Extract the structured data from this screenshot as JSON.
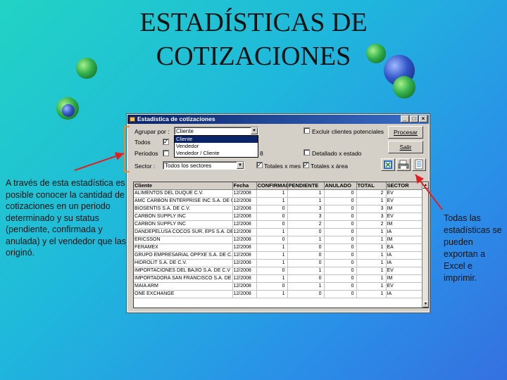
{
  "slide": {
    "title_line1": "ESTADÍSTICAS DE",
    "title_line2": "COTIZACIONES",
    "note_left": "A través de esta estadística es posible conocer la cantidad de cotizaciones en un periodo determinado y su status (pendiente, confirmada y anulada) y el vendedor que las originó.",
    "note_right": "Todas las estadísticas se pueden exportan a Excel e imprimir."
  },
  "window": {
    "title": "Estadística de cotizaciones",
    "controls": {
      "minimize": "_",
      "maximize": "□",
      "close": "×"
    }
  },
  "form": {
    "agrupar_label": "Agrupar por :",
    "agrupar_value": "Cliente",
    "agrupar_options": [
      "Cliente",
      "Vendedor",
      "Vendedor / Cliente"
    ],
    "todos_label": "Todos",
    "todos_checked": "✓",
    "periodos_label": "Periodos",
    "periodo_tail": "8",
    "sector_label": "Sector :",
    "sector_value": "Todos los sectores",
    "excluir_label": "Excluir clientes potenciales",
    "detallado_label": "Detallado x estado",
    "totales_mes_label": "Totales x mes",
    "totales_mes_checked": "✓",
    "totales_area_label": "Totales x área",
    "totales_area_checked": "✓",
    "procesar_button": "Procesar",
    "salir_button": "Salir",
    "icons": [
      "export-excel-icon",
      "print-icon",
      "preview-icon"
    ]
  },
  "grid": {
    "headers": [
      "Cliente",
      "Fecha",
      "CONFIRMADA",
      "PENDIENTE",
      "ANULADO",
      "TOTAL",
      "SECTOR"
    ],
    "rows": [
      [
        "ALIMENTOS DEL DUQUE C.V.",
        "12/2008",
        "1",
        "1",
        "0",
        "2",
        "EV"
      ],
      [
        "AMC CARBON ENTERPRISE INC S.A. DE C",
        "12/2008",
        "1",
        "1",
        "0",
        "1",
        "EV"
      ],
      [
        "BIOSENTIS S.A. DE C.V.",
        "12/2008",
        "0",
        "3",
        "0",
        "3",
        "IM"
      ],
      [
        "CARBON SUPPLY INC",
        "12/2008",
        "0",
        "3",
        "0",
        "3",
        "EV"
      ],
      [
        "CARBON SUPPLY INC",
        "12/2008",
        "0",
        "2",
        "0",
        "2",
        "IM"
      ],
      [
        "DANDEPELUSA COCOS SUR, EPS S.A. DE",
        "12/2008",
        "1",
        "0",
        "0",
        "1",
        "IA"
      ],
      [
        "ERICSSON",
        "12/2008",
        "0",
        "1",
        "0",
        "1",
        "IM"
      ],
      [
        "FERAMEX",
        "12/2008",
        "1",
        "0",
        "0",
        "1",
        "EA"
      ],
      [
        "GRUPO EMPRESARIAL OPPXE S.A. DE C.V",
        "12/2008",
        "1",
        "0",
        "0",
        "1",
        "IA"
      ],
      [
        "HIDROLIT S.A. DE C.V.",
        "12/2008",
        "1",
        "0",
        "0",
        "1",
        "IA"
      ],
      [
        "IMPORTACIONES DEL BAJIO S.A. DE C.V",
        "12/2008",
        "0",
        "1",
        "0",
        "1",
        "EV"
      ],
      [
        "IMPORTADORA SAN FRANCISCO S.A. DE",
        "12/2008",
        "1",
        "0",
        "0",
        "1",
        "IM"
      ],
      [
        "MAIA ARM",
        "12/2008",
        "0",
        "1",
        "0",
        "1",
        "EV"
      ],
      [
        "ONE EXCHANGE",
        "12/2008",
        "1",
        "0",
        "0",
        "1",
        "IA"
      ]
    ]
  },
  "colors": {
    "background_start": "#22d3c4",
    "background_end": "#3570e0",
    "arrow": "#e02020",
    "bracket": "#e88a30",
    "titlebar": "#0a246a"
  }
}
